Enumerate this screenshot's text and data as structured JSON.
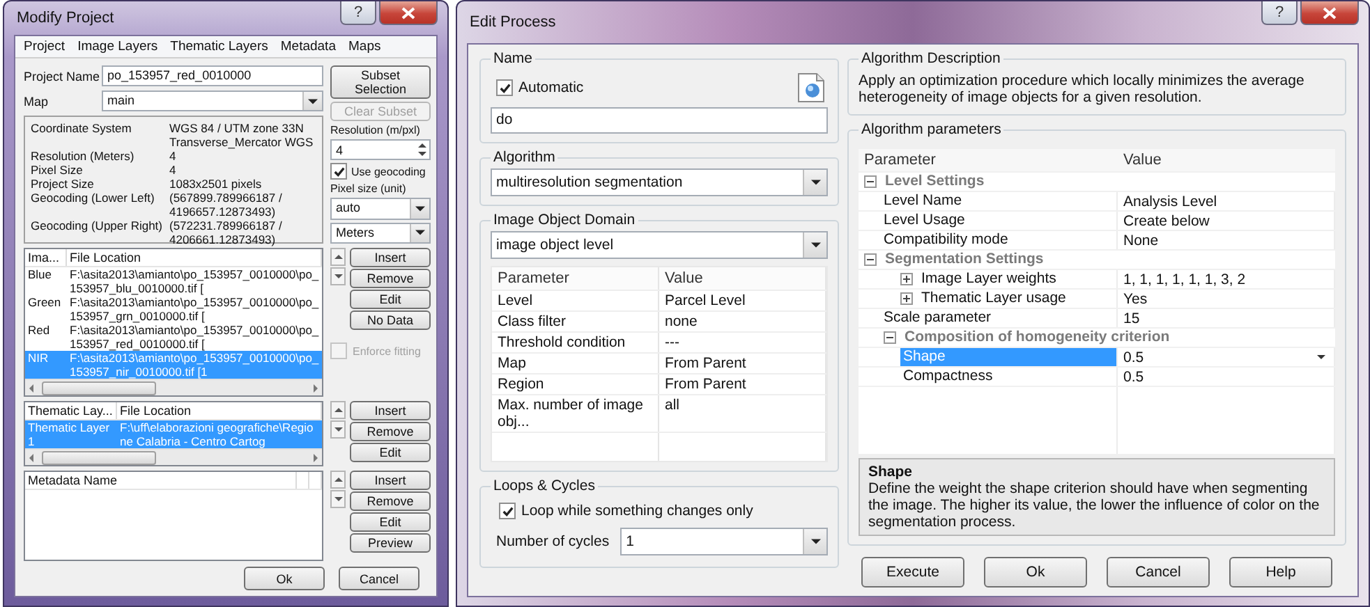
{
  "modify_project": {
    "title": "Modify Project",
    "help_button": "?",
    "menu": [
      "Project",
      "Image Layers",
      "Thematic Layers",
      "Metadata",
      "Maps"
    ],
    "project_name": {
      "label": "Project Name",
      "value": "po_153957_red_0010000"
    },
    "map": {
      "label": "Map",
      "value": "main"
    },
    "subset_button": "Subset Selection",
    "info": [
      {
        "key": "Coordinate System",
        "value": "WGS 84 / UTM zone 33N  Transverse_Mercator  WGS"
      },
      {
        "key": "Resolution (Meters)",
        "value": "4"
      },
      {
        "key": "Pixel Size",
        "value": "4"
      },
      {
        "key": "Project Size",
        "value": "1083x2501 pixels"
      },
      {
        "key": "Geocoding (Lower Left)",
        "value": "(567899.789966187 / 4196657.12873493)"
      },
      {
        "key": "Geocoding (Upper Right)",
        "value": "(572231.789966187 / 4206661.12873493)"
      }
    ],
    "clear_subset": {
      "label": "Clear Subset",
      "disabled": true
    },
    "resolution": {
      "label": "Resolution (m/pxl)",
      "value": "4"
    },
    "use_geocoding": {
      "label": "Use geocoding",
      "checked": true
    },
    "pixel_size": {
      "label": "Pixel size (unit)",
      "values": [
        "auto",
        "Meters"
      ]
    },
    "image_layers": {
      "columns": [
        "Ima...",
        "File Location"
      ],
      "rows": [
        {
          "name": "Blue",
          "path": "F:\\asita2013\\amianto\\po_153957_0010000\\po_153957_blu_0010000.tif [",
          "selected": false
        },
        {
          "name": "Green",
          "path": "F:\\asita2013\\amianto\\po_153957_0010000\\po_153957_grn_0010000.tif [",
          "selected": false
        },
        {
          "name": "Red",
          "path": "F:\\asita2013\\amianto\\po_153957_0010000\\po_153957_red_0010000.tif [",
          "selected": false
        },
        {
          "name": "NIR",
          "path": "F:\\asita2013\\amianto\\po_153957_0010000\\po_153957_nir_0010000.tif [1",
          "selected": true
        }
      ]
    },
    "image_buttons": [
      "Insert",
      "Remove",
      "Edit",
      "No Data"
    ],
    "enforce_fitting": {
      "label": "Enforce fitting",
      "checked": false,
      "disabled": true
    },
    "thematic_layers": {
      "columns": [
        "Thematic Lay...",
        "File Location"
      ],
      "rows": [
        {
          "name": "Thematic Layer 1",
          "path": "F:\\uff\\elaborazioni geografiche\\Regione Calabria - Centro Cartog",
          "selected": true
        }
      ]
    },
    "thematic_buttons": [
      "Insert",
      "Remove",
      "Edit"
    ],
    "metadata": {
      "columns": [
        "Metadata Name"
      ]
    },
    "metadata_buttons": [
      "Insert",
      "Remove",
      "Edit",
      "Preview"
    ],
    "footer_buttons": [
      "Ok",
      "Cancel"
    ]
  },
  "edit_process": {
    "title": "Edit Process",
    "help_button": "?",
    "name_group": {
      "title": "Name",
      "automatic": {
        "label": "Automatic",
        "checked": true
      },
      "value": "do"
    },
    "algorithm_group": {
      "title": "Algorithm",
      "value": "multiresolution segmentation"
    },
    "domain_group": {
      "title": "Image Object Domain",
      "value": "image object level",
      "columns": [
        "Parameter",
        "Value"
      ],
      "rows": [
        {
          "parameter": "Level",
          "value": "Parcel Level"
        },
        {
          "parameter": "Class filter",
          "value": "none"
        },
        {
          "parameter": "Threshold condition",
          "value": "---"
        },
        {
          "parameter": "Map",
          "value": "From Parent"
        },
        {
          "parameter": "Region",
          "value": "From Parent"
        },
        {
          "parameter": "Max. number of image obj...",
          "value": "all"
        }
      ]
    },
    "loops_group": {
      "title": "Loops & Cycles",
      "loop": {
        "label": "Loop while something changes only",
        "checked": true
      },
      "cycles": {
        "label": "Number of cycles",
        "value": "1"
      }
    },
    "description_group": {
      "title": "Algorithm Description",
      "text": "Apply an optimization procedure which locally minimizes the average heterogeneity of image objects for a given resolution."
    },
    "parameters_group": {
      "title": "Algorithm parameters",
      "columns": [
        "Parameter",
        "Value"
      ],
      "rows": [
        {
          "kind": "section",
          "label": "Level Settings",
          "expanded": true,
          "selected": false,
          "children": [
            {
              "kind": "param",
              "label": "Level Name",
              "value": "Analysis Level",
              "selected": false
            },
            {
              "kind": "param",
              "label": "Level Usage",
              "value": "Create below",
              "selected": false
            },
            {
              "kind": "param",
              "label": "Compatibility mode",
              "value": "None",
              "selected": false
            }
          ]
        },
        {
          "kind": "section",
          "label": "Segmentation Settings",
          "expanded": true,
          "selected": false,
          "children": [
            {
              "kind": "param",
              "label": "Image Layer weights",
              "value": "1, 1, 1, 1, 1, 1, 3, 2",
              "expanded": false,
              "selected": false
            },
            {
              "kind": "param",
              "label": "Thematic Layer usage",
              "value": "Yes",
              "expanded": false,
              "selected": false
            },
            {
              "kind": "param",
              "label": "Scale parameter",
              "value": "15",
              "selected": false
            },
            {
              "kind": "section",
              "label": "Composition of homogeneity criterion",
              "expanded": true,
              "selected": false,
              "children": [
                {
                  "kind": "param",
                  "label": "Shape",
                  "value": "0.5",
                  "selected": true
                },
                {
                  "kind": "param",
                  "label": "Compactness",
                  "value": "0.5",
                  "selected": false
                }
              ]
            }
          ]
        }
      ]
    },
    "help_box": {
      "title": "Shape",
      "text": "Define the weight the shape criterion should have when segmenting the image. The higher its value, the lower the influence of color on the segmentation process."
    },
    "buttons": [
      "Execute",
      "Ok",
      "Cancel",
      "Help"
    ]
  }
}
